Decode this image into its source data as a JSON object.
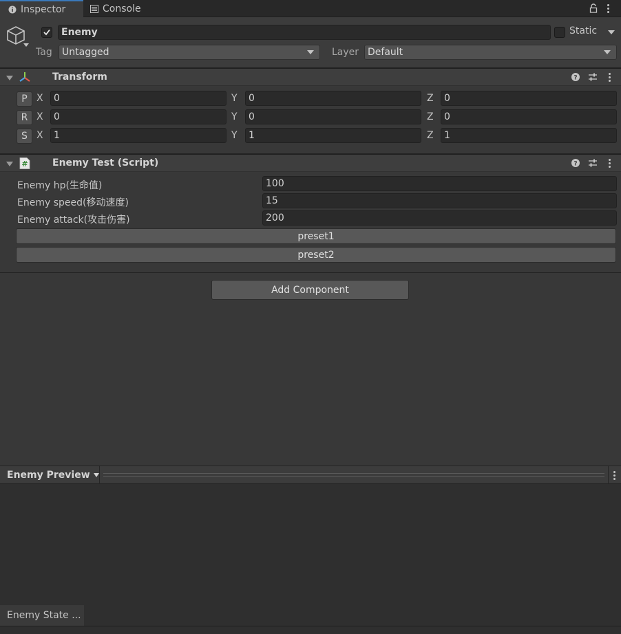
{
  "tabs": [
    {
      "label": "Inspector",
      "icon": "info-icon"
    },
    {
      "label": "Console",
      "icon": "console-icon"
    }
  ],
  "header": {
    "object_name": "Enemy",
    "active": true,
    "static_label": "Static",
    "static_checked": false,
    "tag_label": "Tag",
    "tag_value": "Untagged",
    "layer_label": "Layer",
    "layer_value": "Default"
  },
  "transform": {
    "title": "Transform",
    "rows": [
      {
        "button": "P",
        "x": "0",
        "y": "0",
        "z": "0"
      },
      {
        "button": "R",
        "x": "0",
        "y": "0",
        "z": "0"
      },
      {
        "button": "S",
        "x": "1",
        "y": "1",
        "z": "1"
      }
    ],
    "axes": {
      "x": "X",
      "y": "Y",
      "z": "Z"
    }
  },
  "script": {
    "title": "Enemy Test (Script)",
    "fields": [
      {
        "label": "Enemy hp(生命值)",
        "value": "100"
      },
      {
        "label": "Enemy speed(移动速度)",
        "value": "15"
      },
      {
        "label": "Enemy attack(攻击伤害)",
        "value": "200"
      }
    ],
    "buttons": [
      "preset1",
      "preset2"
    ]
  },
  "add_component_label": "Add Component",
  "preview": {
    "title": "Enemy Preview",
    "state_label": "Enemy State ..."
  },
  "colors": {
    "accent": "#3a79bb",
    "panel": "#383838",
    "field": "#2a2a2a"
  }
}
